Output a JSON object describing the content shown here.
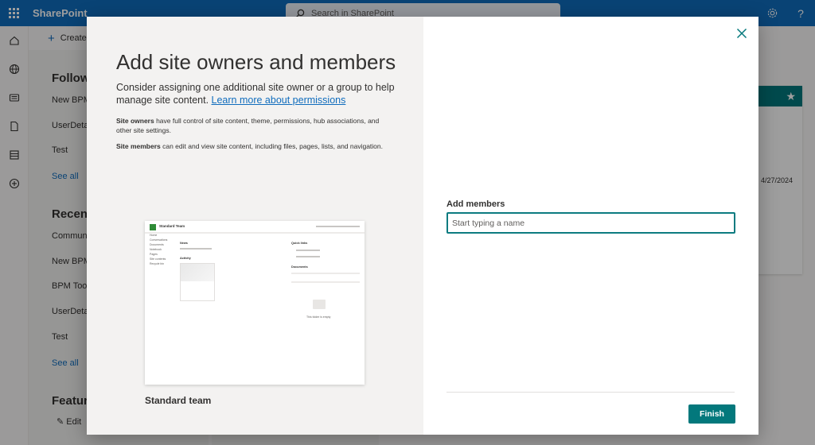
{
  "suitebar": {
    "app_name": "SharePoint",
    "search_placeholder": "Search in SharePoint",
    "settings_icon": "gear-icon",
    "help_label": "?"
  },
  "appbar": {
    "icons": [
      "home-icon",
      "globe-icon",
      "news-icon",
      "document-icon",
      "list-icon",
      "add-circle-icon"
    ]
  },
  "background": {
    "create_label": "Create",
    "following_heading": "Follow",
    "following_items": [
      "New BPM",
      "UserDetai",
      "Test"
    ],
    "following_see_all": "See all",
    "recent_heading": "Recent",
    "recent_items": [
      "Communi",
      "New BPM",
      "BPM Tool",
      "UserDetai",
      "Test"
    ],
    "recent_see_all": "See all",
    "featured_heading": "Feature",
    "featured_edit": "Edit",
    "card_date": "4/27/2024"
  },
  "modal": {
    "title": "Add site owners and members",
    "subtitle": "Consider assigning one additional site owner or a group to help manage site content.",
    "learn_more_link": "Learn more about permissions",
    "owners_term": "Site owners",
    "owners_desc": " have full control of site content, theme, permissions, hub associations, and other site settings.",
    "members_term": "Site members",
    "members_desc": " can edit and view site content, including files, pages, lists, and navigation.",
    "template_name": "Standard team",
    "add_members_label": "Add members",
    "add_members_placeholder": "Start typing a name",
    "finish_label": "Finish",
    "accent_color": "#03787c"
  },
  "thumbnail": {
    "site_title": "Standard Team",
    "nav": [
      "Home",
      "Conversations",
      "Documents",
      "Notebook",
      "Pages",
      "Site contents",
      "Recycle bin"
    ],
    "news_heading": "News",
    "activity_heading": "Activity",
    "quick_links_heading": "Quick links",
    "documents_heading": "Documents",
    "empty_text": "This folder is empty"
  }
}
